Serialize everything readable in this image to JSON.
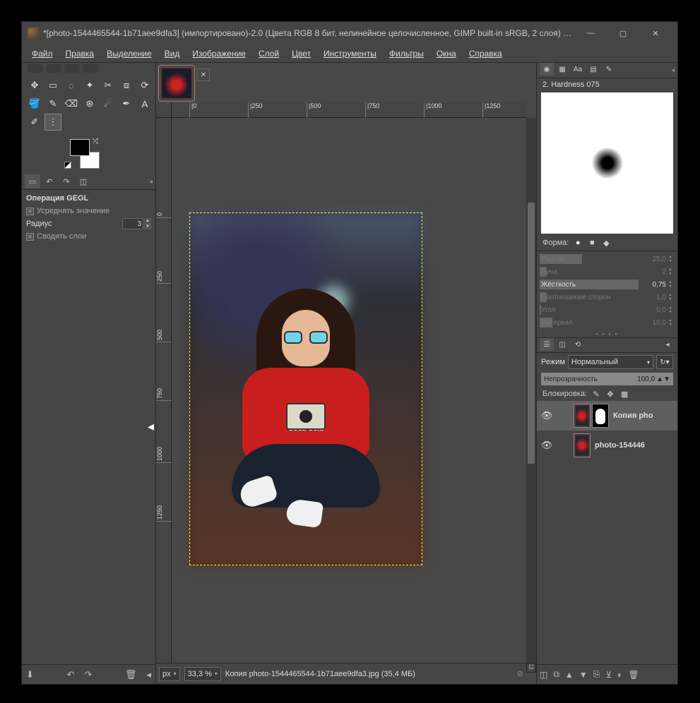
{
  "titlebar": {
    "title": "*[photo-1544465544-1b71aee9dfa3] (импортировано)-2.0 (Цвета RGB 8 бит, нелинейное целочисленное, GIMP built-in sRGB, 2 слоя) 1000..."
  },
  "menubar": [
    "Файл",
    "Правка",
    "Выделение",
    "Вид",
    "Изображение",
    "Слой",
    "Цвет",
    "Инструменты",
    "Фильтры",
    "Окна",
    "Справка"
  ],
  "ruler_h": [
    0,
    250,
    500,
    750,
    1000,
    1250
  ],
  "ruler_v": [
    0,
    250,
    500,
    750,
    1000,
    1250
  ],
  "tool_options": {
    "title": "Операция GEGL",
    "row1": "Усреднять значение",
    "radius_label": "Радиус",
    "radius_value": "3",
    "row3": "Сводить слои"
  },
  "statusbar": {
    "unit": "px",
    "zoom": "33,3 %",
    "text": "Копия photo-1544465544-1b71aee9dfa3.jpg (35,4 МБ)"
  },
  "brush": {
    "label": "2. Hardness 075",
    "shape_label": "Форма:"
  },
  "sliders": [
    {
      "label": "Радиус",
      "value": "25,0",
      "dim": true,
      "bar": 60
    },
    {
      "label": "Лучи",
      "value": "2",
      "dim": true,
      "bar": 10
    },
    {
      "label": "Жёсткость",
      "value": "0,75",
      "dim": false,
      "bar": 140
    },
    {
      "label": "Соотношение сторон",
      "value": "1,0",
      "dim": true,
      "bar": 10
    },
    {
      "label": "Угол",
      "value": "0,0",
      "dim": true,
      "bar": 2
    },
    {
      "label": "Интервал",
      "value": "10,0",
      "dim": true,
      "bar": 18
    }
  ],
  "layer_panel": {
    "mode_label": "Режим",
    "mode_value": "Нормальный",
    "opacity_label": "Непрозрачность",
    "opacity_value": "100,0",
    "lock_label": "Блокировка:"
  },
  "layers": [
    {
      "name": "Копия pho",
      "mask": true,
      "selected": true
    },
    {
      "name": "photo-154446",
      "mask": false,
      "selected": false
    }
  ],
  "subject_logo": "Coca-Cola"
}
